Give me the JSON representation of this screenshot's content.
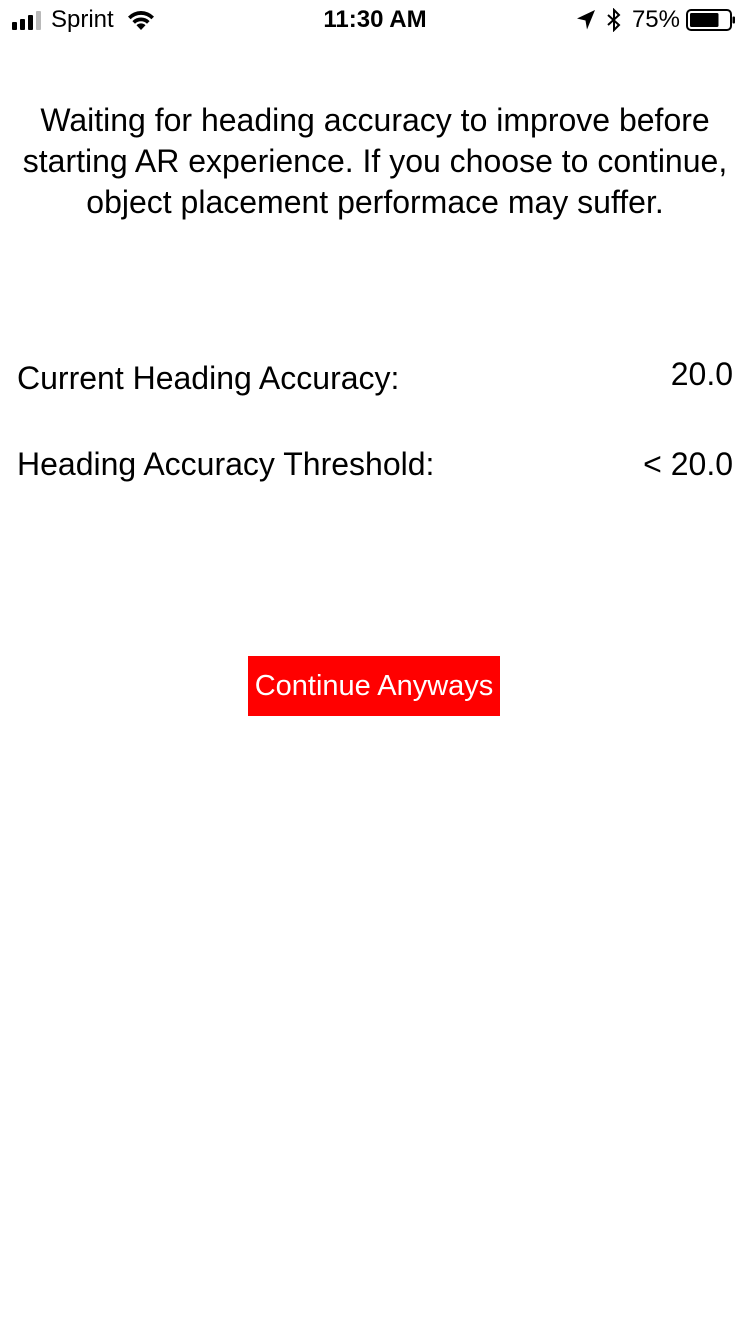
{
  "status_bar": {
    "carrier": "Sprint",
    "time": "11:30 AM",
    "battery_percent": "75%",
    "signal_bars_active": 3,
    "signal_bars_total": 4,
    "battery_level": 0.75,
    "icons": [
      "signal-icon",
      "wifi-icon",
      "location-arrow-icon",
      "bluetooth-icon",
      "battery-icon"
    ]
  },
  "message": "Waiting for heading accuracy to improve before starting AR experience.  If you choose to continue, object placement performace may suffer.",
  "info": {
    "current": {
      "label": "Current Heading Accuracy:",
      "value": "20.0"
    },
    "threshold": {
      "label": "Heading Accuracy Threshold:",
      "value": "< 20.0"
    }
  },
  "actions": {
    "continue_label": "Continue Anyways"
  },
  "colors": {
    "background": "#ffffff",
    "text": "#000000",
    "button_background": "#ff0000",
    "button_text": "#ffffff"
  }
}
